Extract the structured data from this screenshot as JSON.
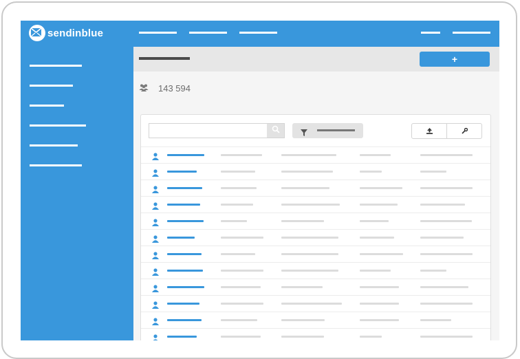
{
  "app": {
    "brand": "sendinblue",
    "accent_color": "#3997dc"
  },
  "subheader": {
    "add_label": "+"
  },
  "summary": {
    "icon": "users-icon",
    "count_text": "143 594"
  },
  "toolbar": {
    "search_icon": "search-icon",
    "filter_icon": "filter-icon",
    "export_icon": "upload-icon",
    "settings_icon": "wrench-icon"
  },
  "contacts": {
    "row_count": 12,
    "row_icon": "user-icon"
  }
}
